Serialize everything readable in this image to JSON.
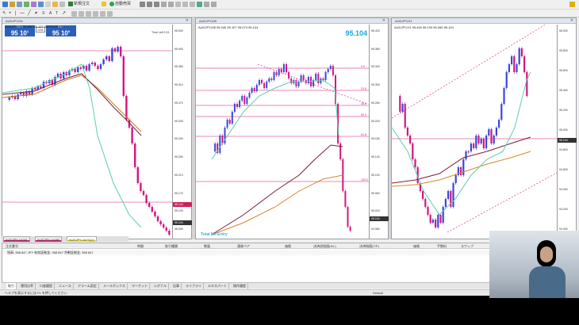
{
  "toolbar": {
    "new_order": "新規注文",
    "auto_trade": "自動売買"
  },
  "charts": [
    {
      "title": "AUDJPY,M1",
      "info": "AUDJPY,M1 95.080 95.107 95.073 95.104",
      "sell_label": "SELL",
      "buy_label": "BUY",
      "lot": "0.02",
      "sell_big": "95 10",
      "sell_sup": "1",
      "buy_big": "95 10",
      "buy_sup": "9",
      "prices": [
        "95.530",
        "95.490",
        "95.450",
        "95.410",
        "95.370",
        "95.330",
        "95.290",
        "95.250",
        "95.210",
        "95.170",
        "95.130",
        "95.090"
      ],
      "cur_price": "95.104",
      "line_label": "95.144",
      "clock": "Time Left 2:03"
    },
    {
      "title": "AUDJPY,M5",
      "info": "AUDJPY,M5 95.040 95.107 95.073 95.104",
      "price_big": "95.104",
      "prices": [
        "95.420",
        "95.380",
        "95.340",
        "95.300",
        "95.260",
        "95.220",
        "95.180",
        "95.140",
        "95.100",
        "95.060",
        "95.020",
        "94.980"
      ],
      "cur_price": "95.104",
      "fibo": [
        "0.0",
        "23.6",
        "38.2",
        "50.0",
        "61.8",
        "100.0"
      ],
      "overlay": "Total No Entry"
    },
    {
      "title": "AUDJPY,H1",
      "info": "AUDJPY,H1 95.490 95.193 95.060 95.104",
      "prices": [
        "96.000",
        "95.800",
        "95.600",
        "95.400",
        "95.200",
        "95.000",
        "94.800",
        "94.600",
        "94.400",
        "94.200",
        "94.000"
      ],
      "cur_price": "95.104"
    }
  ],
  "chart_tabs": [
    "AUDJPY-cd,M1",
    "AUDJPY-cd,M5",
    "AUDJPY-cd,H1(c)"
  ],
  "terminal": {
    "headers": [
      "注文番号",
      "時間",
      "取引種類",
      "数量",
      "通貨ペア",
      "価格",
      "決済逆指値(S/L)",
      "決済指値(T/P)",
      "価格",
      "手数料",
      "スワップ",
      "損益"
    ],
    "balance": "残高: 358 847 JPY  有効証拠金: 358 847  余剰証拠金: 358 847",
    "tabs": [
      "取引",
      "運用比率",
      "口座履歴",
      "ニュース",
      "アラーム設定",
      "メールボックス",
      "マーケット",
      "シグナル",
      "記事",
      "ライブラリ",
      "エキスパート",
      "操作履歴"
    ]
  },
  "status": {
    "help": "ヘルプを表示するには F1 を押してください",
    "profile": "Default"
  }
}
